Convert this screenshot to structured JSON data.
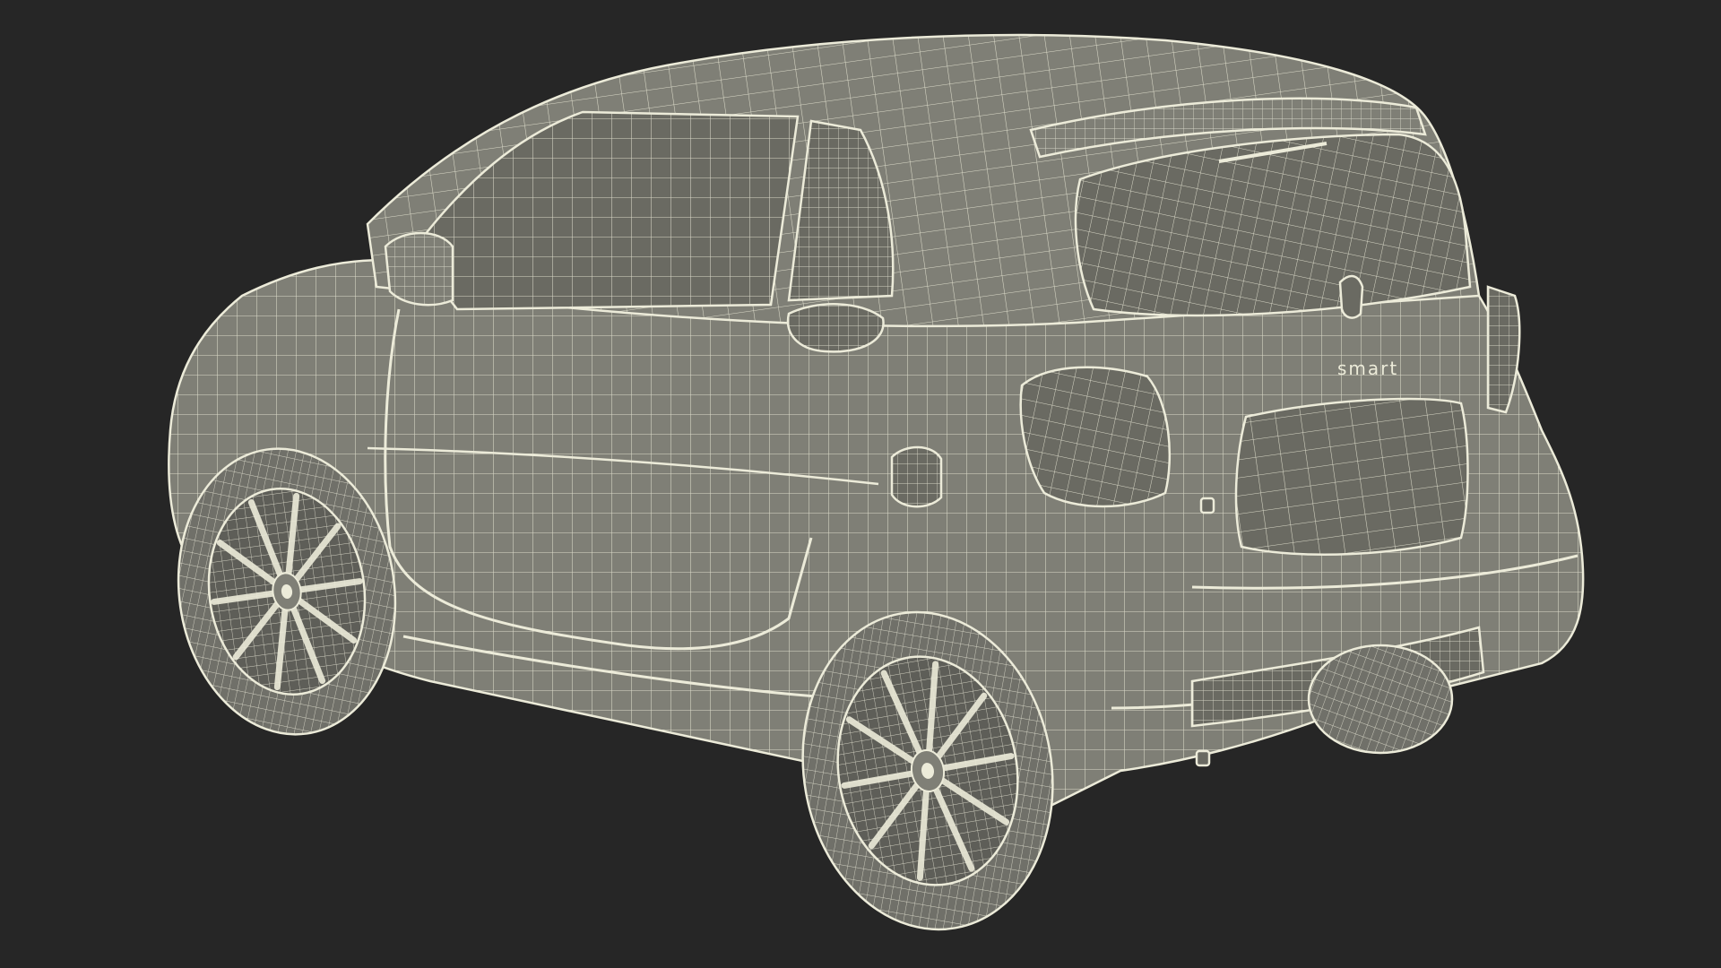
{
  "scene": {
    "background_color": "#262626",
    "mesh_fill_color": "#7f7f76",
    "mesh_fill_shadow": "#6a6a62",
    "wire_color": "#ecebd9",
    "wire_color_dim": "#c8c7b6",
    "tire_color": "#707069",
    "rim_color": "#5e5e58",
    "subject": "wireframe-car-rear-three-quarter"
  },
  "badge": {
    "text": "smart"
  }
}
